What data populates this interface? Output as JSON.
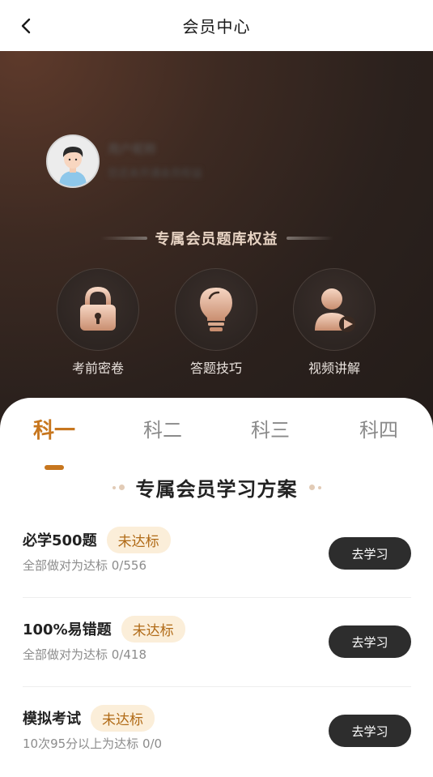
{
  "header": {
    "title": "会员中心",
    "back_icon": "chevron-left-icon"
  },
  "user": {
    "name": "用户昵称",
    "subtitle": "您还未开通会员权益"
  },
  "benefits": {
    "heading": "专属会员题库权益",
    "items": [
      {
        "label": "考前密卷",
        "icon": "lock-icon"
      },
      {
        "label": "答题技巧",
        "icon": "lightbulb-icon"
      },
      {
        "label": "视频讲解",
        "icon": "video-person-icon"
      }
    ]
  },
  "tabs": [
    {
      "label": "科一",
      "active": true
    },
    {
      "label": "科二",
      "active": false
    },
    {
      "label": "科三",
      "active": false
    },
    {
      "label": "科四",
      "active": false
    }
  ],
  "plan_section": {
    "title": "专属会员学习方案",
    "items": [
      {
        "name": "必学500题",
        "badge": "未达标",
        "desc": "全部做对为达标 0/556",
        "button": "去学习"
      },
      {
        "name": "100%易错题",
        "badge": "未达标",
        "desc": "全部做对为达标 0/418",
        "button": "去学习"
      },
      {
        "name": "模拟考试",
        "badge": "未达标",
        "desc": "10次95分以上为达标 0/0",
        "button": "去学习"
      }
    ]
  },
  "colors": {
    "accent": "#c7761e",
    "badge_bg": "#fbeed9",
    "button_bg": "#2d2d2d",
    "hero_bg": "#2b211d"
  }
}
